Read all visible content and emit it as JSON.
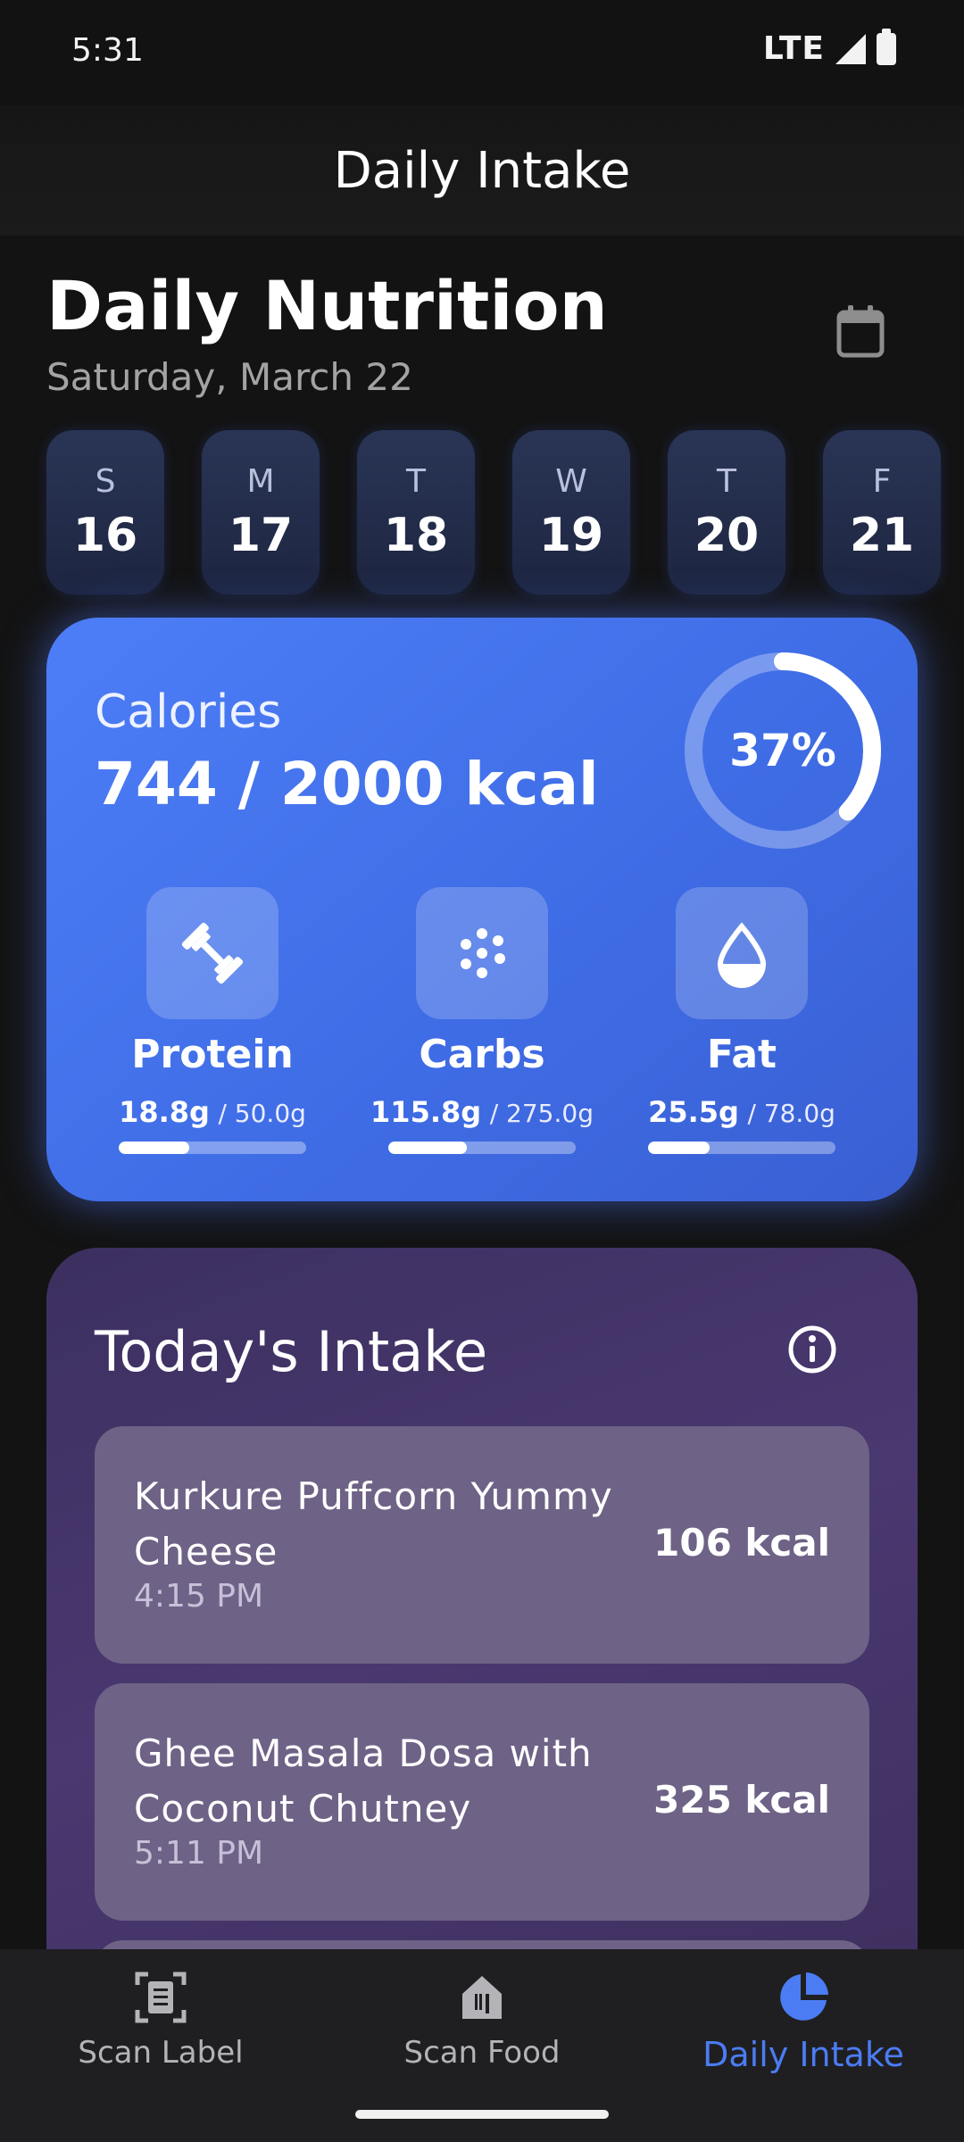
{
  "status_bar": {
    "time": "5:31",
    "network": "LTE"
  },
  "app_bar": {
    "title": "Daily Intake"
  },
  "header": {
    "title": "Daily Nutrition",
    "date": "Saturday, March 22",
    "calendar_icon": "calendar-icon"
  },
  "days": [
    {
      "letter": "S",
      "num": "16"
    },
    {
      "letter": "M",
      "num": "17"
    },
    {
      "letter": "T",
      "num": "18"
    },
    {
      "letter": "W",
      "num": "19"
    },
    {
      "letter": "T",
      "num": "20"
    },
    {
      "letter": "F",
      "num": "21"
    }
  ],
  "calories": {
    "label": "Calories",
    "value_text": "744 / 2000 kcal",
    "percent_text": "37%",
    "progress": 0.37,
    "ring_color": "#ffffff"
  },
  "macros": [
    {
      "name": "Protein",
      "amount": "18.8g",
      "target": "/ 50.0g",
      "progress": 0.376,
      "icon": "dumbbell-icon"
    },
    {
      "name": "Carbs",
      "amount": "115.8g",
      "target": "/ 275.0g",
      "progress": 0.421,
      "icon": "grain-dots-icon"
    },
    {
      "name": "Fat",
      "amount": "25.5g",
      "target": "/ 78.0g",
      "progress": 0.327,
      "icon": "droplet-icon"
    }
  ],
  "intake": {
    "title": "Today's Intake",
    "info_icon": "info-icon",
    "entries": [
      {
        "name": "Kurkure Puffcorn Yummy Cheese",
        "time": "4:15 PM",
        "kcal": "106 kcal"
      },
      {
        "name": "Ghee Masala Dosa with Coconut Chutney",
        "time": "5:11 PM",
        "kcal": "325 kcal"
      }
    ]
  },
  "nav": {
    "items": [
      {
        "label": "Scan Label",
        "icon": "scan-label-icon",
        "active": false
      },
      {
        "label": "Scan Food",
        "icon": "scan-food-icon",
        "active": false
      },
      {
        "label": "Daily Intake",
        "icon": "pie-chart-icon",
        "active": true
      }
    ],
    "accent": "#4c7cf3"
  }
}
